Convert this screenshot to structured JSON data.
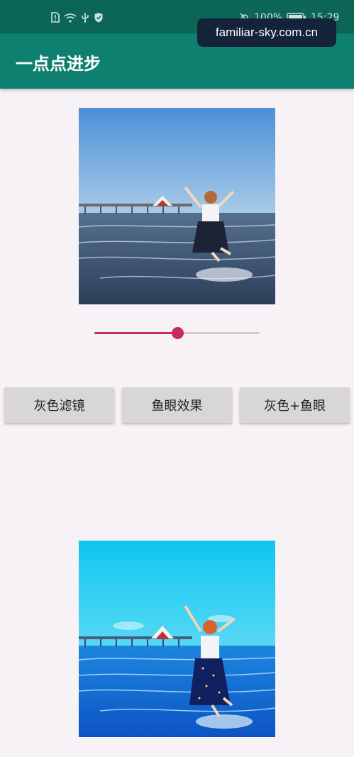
{
  "status_bar": {
    "battery": "100%",
    "time": "15:29"
  },
  "watermark": "familiar-sky.com.cn",
  "app_bar": {
    "title": "一点点进步"
  },
  "slider": {
    "value": 0.5
  },
  "buttons": {
    "gray_filter": "灰色滤镜",
    "fisheye": "鱼眼效果",
    "gray_fisheye": "灰色+鱼眼"
  },
  "colors": {
    "status_bar": "#0b6656",
    "app_bar": "#0f8070",
    "accent": "#c72c5c",
    "background": "#f6f2f5"
  }
}
